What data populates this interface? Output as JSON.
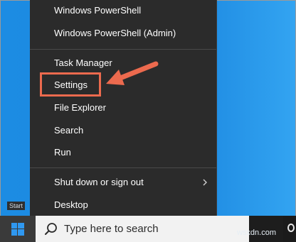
{
  "menu": {
    "items": [
      {
        "label": "Windows PowerShell",
        "has_submenu": false
      },
      {
        "label": "Windows PowerShell (Admin)",
        "has_submenu": false
      },
      {
        "label": "Task Manager",
        "has_submenu": false
      },
      {
        "label": "Settings",
        "has_submenu": false
      },
      {
        "label": "File Explorer",
        "has_submenu": false
      },
      {
        "label": "Search",
        "has_submenu": false
      },
      {
        "label": "Run",
        "has_submenu": false
      },
      {
        "label": "Shut down or sign out",
        "has_submenu": true
      },
      {
        "label": "Desktop",
        "has_submenu": false
      }
    ]
  },
  "taskbar": {
    "start_tooltip": "Start",
    "search_placeholder": "Type here to search"
  },
  "watermark": "wsxdn.com",
  "colors": {
    "highlight": "#ec6a4e",
    "menu_bg": "#2b2b2b",
    "desktop": "#1a86df"
  }
}
